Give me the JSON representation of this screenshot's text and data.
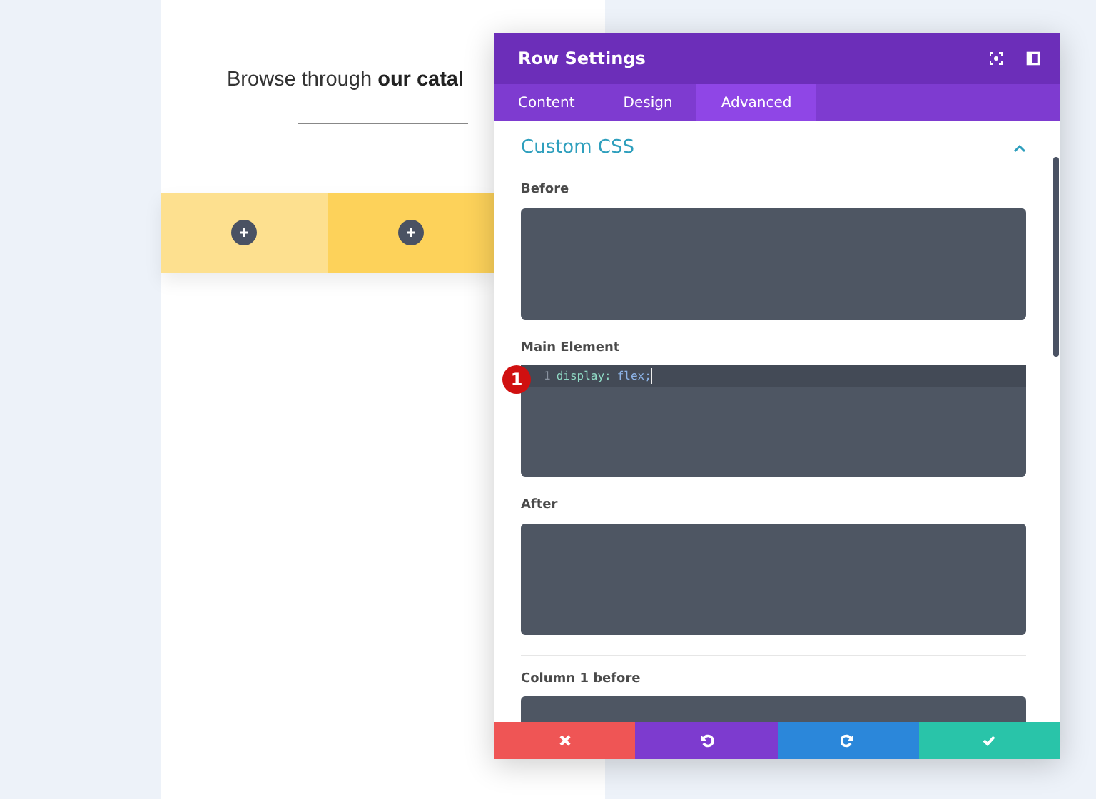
{
  "page": {
    "heading": "Browse through **our catal**",
    "columns": [
      {
        "color": "#fde08f"
      },
      {
        "color": "#fdd25a"
      }
    ]
  },
  "modal": {
    "title": "Row Settings",
    "tabs": [
      {
        "label": "Content",
        "selected": false
      },
      {
        "label": "Design",
        "selected": false
      },
      {
        "label": "Advanced",
        "selected": true
      }
    ],
    "section": {
      "title": "Custom CSS",
      "expanded": true
    },
    "fields": [
      {
        "label": "Before"
      },
      {
        "label": "Main Element",
        "annotation": "1",
        "lines": [
          {
            "number": "1",
            "property": "display:",
            "value": "flex;"
          }
        ]
      },
      {
        "label": "After"
      },
      {
        "label": "Column 1 before"
      }
    ],
    "buttons": [
      {
        "kind": "cancel",
        "color": "#ef5555"
      },
      {
        "kind": "undo",
        "color": "#7d3bcf"
      },
      {
        "kind": "redo",
        "color": "#2b87da"
      },
      {
        "kind": "save",
        "color": "#29c4a9"
      }
    ]
  }
}
